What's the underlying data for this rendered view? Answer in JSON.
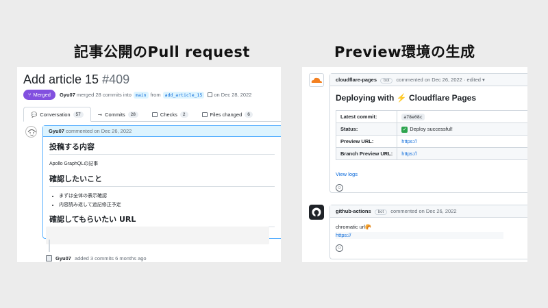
{
  "slide": {
    "left_title": "記事公開のPull request",
    "right_title": "Preview環境の生成"
  },
  "pr": {
    "title": "Add article 15",
    "number": "#409",
    "badge": "Merged",
    "author": "Gyu07",
    "merge_text": "merged 28 commits into",
    "base_branch": "main",
    "from_text": "from",
    "head_branch": "add_article_15",
    "date_text": "on Dec 28, 2022",
    "tabs": [
      {
        "label": "Conversation",
        "count": "57"
      },
      {
        "label": "Commits",
        "count": "28"
      },
      {
        "label": "Checks",
        "count": "2"
      },
      {
        "label": "Files changed",
        "count": "6"
      }
    ],
    "comment": {
      "author": "Gyu07",
      "meta": "commented on Dec 26, 2022",
      "h_content": "投稿する内容",
      "content": "Apollo GraphQLの記事",
      "h_check": "確認したいこと",
      "items": [
        "まずは全体の表示確認",
        "内容読み返して追記修正予定"
      ],
      "h_url": "確認してもらいたい URL"
    },
    "commits_event": {
      "author": "Gyu07",
      "text": "added 3 commits 6 months ago"
    }
  },
  "cloudflare": {
    "author": "cloudflare-pages",
    "bot": "bot",
    "meta": "commented on Dec 26, 2022 · edited ▾",
    "heading_pre": "Deploying with",
    "heading_bolt": "⚡",
    "heading_post": "Cloudflare Pages",
    "rows": [
      {
        "key": "Latest commit:",
        "value": "a78e08c"
      },
      {
        "key": "Status:",
        "value": "Deploy successful!"
      },
      {
        "key": "Preview URL:",
        "value": "https://"
      },
      {
        "key": "Branch Preview URL:",
        "value": "https://"
      }
    ],
    "view_logs": "View logs"
  },
  "github_actions": {
    "author": "github-actions",
    "bot": "bot",
    "meta": "commented on Dec 26, 2022",
    "text": "chromatic url🥐",
    "url": "https://"
  },
  "colors": {
    "merged": "#8250df",
    "link": "#0969da",
    "cloudflare": "#f38020",
    "highlight_head": "#ddf4ff"
  }
}
